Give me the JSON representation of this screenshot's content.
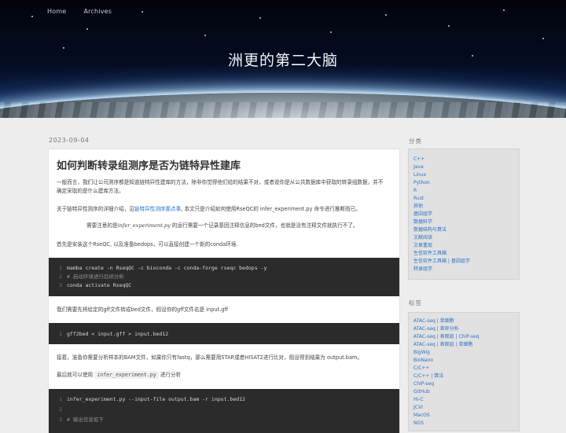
{
  "nav": {
    "items": [
      "Home",
      "Archives"
    ]
  },
  "site_title": "洲更的第二大脑",
  "post": {
    "date": "2023-09-04",
    "title": "如何判断转录组测序是否为链特异性建库",
    "p1": "一般而言，我们让公司测序都是知道链特异性建库的方法，除非你觉得他们给的结果不对，或者说你是从公共数据库中获取的转录组数据，并不确定采取的是什么建库方法。",
    "p2_before": "关于链特异性测序的详细介绍，见",
    "p2_link": "链特异性测序那点事",
    "p2_after": ", 本文只是介绍如何使用RseQC的 infer_experiment.py 命令进行推断而已。",
    "p3_before": "需要注意的是",
    "p3_serif": "infer_experiment.py",
    "p3_after": " 的运行需要一个记录基因注释信息的bed文件，也就是没有注释文件就执行不了。",
    "p4": "首先是安装这个RseQC, 以及准备bedops，可以直接创建一个新的conda环境.",
    "code1": [
      {
        "n": "1",
        "text": "mamba create -n RseqQC -c bioconda -c conda-forge rseqc bedops -y",
        "comment": false
      },
      {
        "n": "2",
        "text": "# 启动环境进行后续分析",
        "comment": true
      },
      {
        "n": "3",
        "text": "conda activate RseqQC",
        "comment": false
      }
    ],
    "p5": "我们需要先将给定的gff文件转成bed文件，假设你的gff文件名是 input.gff",
    "code2": [
      {
        "n": "1",
        "text": "gff2bed < input.gff > input.bed12",
        "comment": false
      }
    ],
    "p6": "接着，准备你需要分析样本的BAM文件，如果你只有fastq，那么需要用STAR或者HISAT2进行比对，假设得到结果为 output.bam。",
    "p7_before": "最后就可以使用 ",
    "p7_code": "infer_experiment.py",
    "p7_after": " 进行分析",
    "code3": [
      {
        "n": "1",
        "text": "infer_experiment.py --input-file output.bam -r input.bed12",
        "comment": false
      },
      {
        "n": "2",
        "text": "",
        "comment": false
      },
      {
        "n": "3",
        "text": "# 输出信息如下",
        "comment": true
      }
    ]
  },
  "sidebar": {
    "categories_heading": "分类",
    "categories": [
      "C++",
      "Java",
      "Linux",
      "Python",
      "R",
      "Rust",
      "其他",
      "基因组学",
      "数据科学",
      "数据结构与算法",
      "文献阅读",
      "文章重现",
      "生信软件工具箱",
      "生信软件工具箱 | 基因组学",
      "转录组学"
    ],
    "tags_heading": "标签",
    "tags": [
      "ATAC-seq | 单细胞",
      "ATAC-seq | 差异分析",
      "ATAC-seq | 表观组 | ChIP-seq",
      "ATAC-seq | 表观组 | 单细胞",
      "BigWig",
      "BioNano",
      "C/C++",
      "C/C++ | 算法",
      "ChIP-seq",
      "GitHub",
      "Hi-C",
      "JCVI",
      "MacOS",
      "NGS"
    ]
  }
}
